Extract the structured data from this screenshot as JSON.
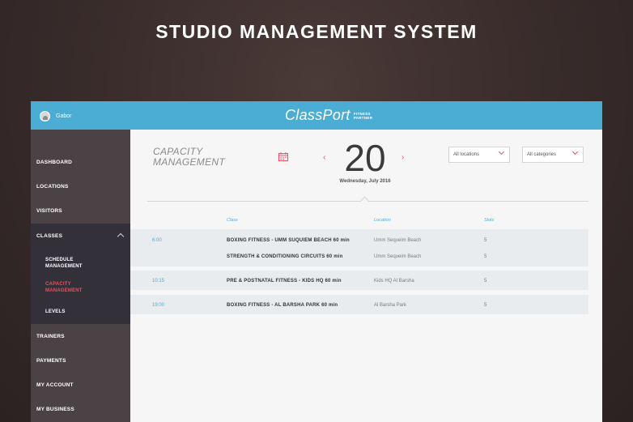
{
  "headline": "STUDIO MANAGEMENT SYSTEM",
  "topbar": {
    "username": "Gabor",
    "logo": "ClassPort",
    "logo_sub_1": "FITNESS",
    "logo_sub_2": "PARTNER"
  },
  "sidebar": {
    "items": [
      {
        "label": "DASHBOARD"
      },
      {
        "label": "LOCATIONS"
      },
      {
        "label": "VISITORS"
      },
      {
        "label": "CLASSES"
      },
      {
        "label": "TRAINERS"
      },
      {
        "label": "PAYMENTS"
      },
      {
        "label": "MY ACCOUNT"
      },
      {
        "label": "MY BUSINESS"
      }
    ],
    "classes_sub": [
      {
        "line1": "SCHEDULE",
        "line2": "MANAGEMENT"
      },
      {
        "line1": "CAPACITY",
        "line2": "MANAGEMENT"
      },
      {
        "line1": "LEVELS",
        "line2": ""
      }
    ]
  },
  "main": {
    "title_line1": "CAPACITY",
    "title_line2": "MANAGEMENT",
    "prev": "‹",
    "next": "›",
    "day": "20",
    "date": "Wednesday, July 2016",
    "filter_locations": "All locations",
    "filter_categories": "All categories"
  },
  "table": {
    "headers": {
      "class": "Class",
      "location": "Location",
      "slots": "Slots"
    },
    "rows": [
      {
        "time": "6:00",
        "class": "BOXING FITNESS - UMM SUQUIEM BEACH 60 min",
        "location": "Umm Sequeim Beach",
        "slots": "5"
      },
      {
        "time": "",
        "class": "STRENGTH & CONDITIONING CIRCUITS 60 min",
        "location": "Umm Sequeim Beach",
        "slots": "5"
      },
      {
        "time": "10:15",
        "class": "PRE & POSTNATAL FITNESS - KIDS HQ 60 min",
        "location": "Kids HQ Al Barsha",
        "slots": "5"
      },
      {
        "time": "19:00",
        "class": "BOXING FITNESS - AL BARSHA PARK 60 min",
        "location": "Al Barsha Park",
        "slots": "5"
      }
    ]
  },
  "colors": {
    "accent": "#4badd3",
    "highlight": "#e2525f",
    "sidebar": "#4a4245"
  }
}
